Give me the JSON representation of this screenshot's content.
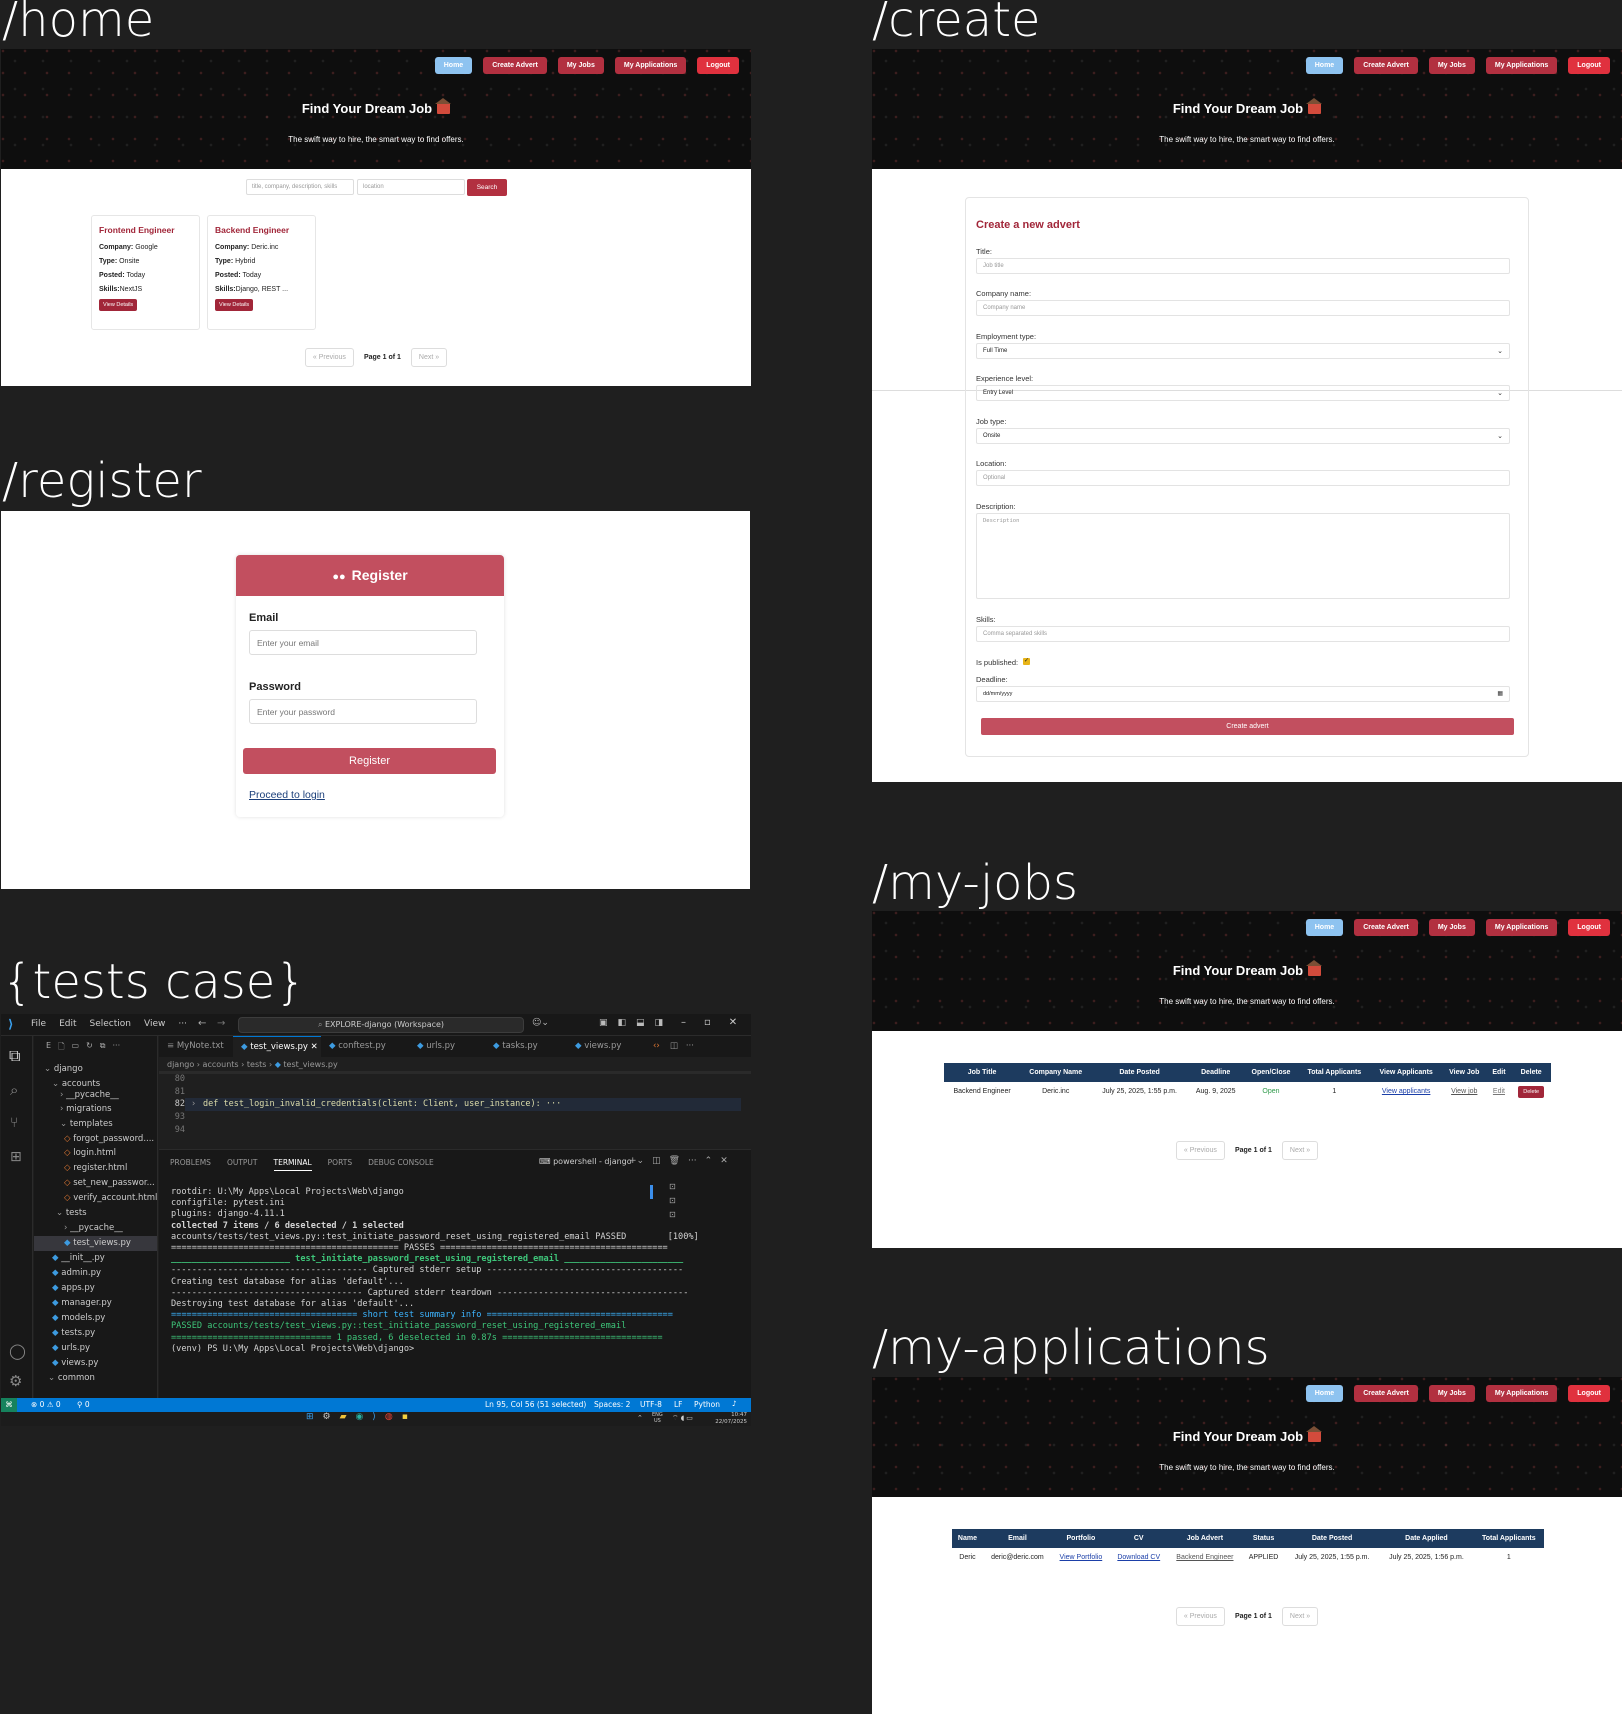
{
  "headings": {
    "home": "/home",
    "create": "/create",
    "register": "/register",
    "my_jobs": "/my-jobs",
    "tests": "{tests case}",
    "my_applications": "/my-applications"
  },
  "site": {
    "nav": [
      "Home",
      "Create Advert",
      "My Jobs",
      "My Applications",
      "Logout"
    ],
    "hero_title": "Find Your Dream Job",
    "hero_subtitle": "The swift way to hire, the smart way to find offers.",
    "pager": {
      "previous": "« Previous",
      "info": "Page 1 of 1",
      "next": "Next »"
    }
  },
  "home": {
    "search_placeholder": "title, company, description, skills",
    "location_placeholder": "location",
    "search_button": "Search",
    "jobs": [
      {
        "title": "Frontend Engineer",
        "company_label": "Company:",
        "company": "Google",
        "type_label": "Type:",
        "type": "Onsite",
        "posted_label": "Posted:",
        "posted": "Today",
        "skills_label": "Skills:",
        "skills": "NextJS",
        "button": "View Details"
      },
      {
        "title": "Backend Engineer",
        "company_label": "Company:",
        "company": "Deric.inc",
        "type_label": "Type:",
        "type": "Hybrid",
        "posted_label": "Posted:",
        "posted": "Today",
        "skills_label": "Skills:",
        "skills": "Django, REST ...",
        "button": "View Details"
      }
    ]
  },
  "register": {
    "title": "Register",
    "email_label": "Email",
    "email_placeholder": "Enter your email",
    "password_label": "Password",
    "password_placeholder": "Enter your password",
    "button": "Register",
    "login_link": "Proceed to login"
  },
  "create": {
    "title": "Create a new advert",
    "fields": {
      "title_label": "Title:",
      "title_placeholder": "Job title",
      "company_label": "Company name:",
      "company_placeholder": "Company name",
      "employment_label": "Employment type:",
      "employment_value": "Full Time",
      "experience_label": "Experience level:",
      "experience_value": "Entry Level",
      "jobtype_label": "Job type:",
      "jobtype_value": "Onsite",
      "location_label": "Location:",
      "location_placeholder": "Optional",
      "description_label": "Description:",
      "description_placeholder": "Description",
      "skills_label": "Skills:",
      "skills_placeholder": "Comma separated skills",
      "published_label": "Is published:",
      "published_checked": true,
      "deadline_label": "Deadline:",
      "deadline_placeholder": "dd/mm/yyyy"
    },
    "button": "Create advert"
  },
  "my_jobs": {
    "headers": [
      "Job Title",
      "Company Name",
      "Date Posted",
      "Deadline",
      "Open/Close",
      "Total Applicants",
      "View Applicants",
      "View Job",
      "Edit",
      "Delete"
    ],
    "row": {
      "title": "Backend Engineer",
      "company": "Deric.inc",
      "posted": "July 25, 2025, 1:55 p.m.",
      "deadline": "Aug. 9, 2025",
      "status": "Open",
      "total": "1",
      "view_applicants": "View applicants",
      "view_job": "View job",
      "edit": "Edit",
      "delete": "Delete"
    }
  },
  "my_applications": {
    "headers": [
      "Name",
      "Email",
      "Portfolio",
      "CV",
      "Job Advert",
      "Status",
      "Date Posted",
      "Date Applied",
      "Total Applicants"
    ],
    "row": {
      "name": "Deric",
      "email": "deric@deric.com",
      "portfolio": "View Portfolio",
      "cv": "Download CV",
      "advert": "Backend Engineer",
      "status": "APPLIED",
      "posted": "July 25, 2025, 1:55 p.m.",
      "applied": "July 25, 2025, 1:56 p.m.",
      "total": "1"
    }
  },
  "vscode": {
    "menu": [
      "File",
      "Edit",
      "Selection",
      "View",
      "···"
    ],
    "search": "EXPLORE-django (Workspace)",
    "tabs": [
      "MyNote.txt",
      "test_views.py",
      "conftest.py",
      "urls.py",
      "tasks.py",
      "views.py"
    ],
    "breadcrumb": [
      "django",
      "accounts",
      "tests",
      "test_views.py"
    ],
    "tree": [
      "django",
      "accounts",
      "__pycache__",
      "migrations",
      "templates",
      "forgot_password....",
      "login.html",
      "register.html",
      "set_new_passwor...",
      "verify_account.html",
      "tests",
      "__pycache__",
      "test_views.py",
      "__init__.py",
      "admin.py",
      "apps.py",
      "manager.py",
      "models.py",
      "tests.py",
      "urls.py",
      "views.py",
      "common"
    ],
    "code_lines": [
      {
        "num": "80",
        "text": ""
      },
      {
        "num": "81",
        "text": ""
      },
      {
        "num": "82",
        "text": "def test_login_invalid_credentials(client: Client, user_instance): ···"
      },
      {
        "num": "93",
        "text": ""
      },
      {
        "num": "94",
        "text": ""
      }
    ],
    "panel_tabs": [
      "PROBLEMS",
      "OUTPUT",
      "TERMINAL",
      "PORTS",
      "DEBUG CONSOLE"
    ],
    "shell": "powershell - django",
    "terminal": [
      "rootdir: U:\\My Apps\\Local Projects\\Web\\django",
      "configfile: pytest.ini",
      "plugins: django-4.11.1",
      "collected 7 items / 6 deselected / 1 selected",
      "",
      "accounts/tests/test_views.py::test_initiate_password_reset_using_registered_email PASSED        [100%]",
      "",
      "============================================ PASSES ============================================",
      "_______________________ test_initiate_password_reset_using_registered_email _______________________",
      "-------------------------------------- Captured stderr setup --------------------------------------",
      "Creating test database for alias 'default'...",
      "------------------------------------- Captured stderr teardown -------------------------------------",
      "Destroying test database for alias 'default'...",
      "==================================== short test summary info ====================================",
      "PASSED accounts/tests/test_views.py::test_initiate_password_reset_using_registered_email",
      "=============================== 1 passed, 6 deselected in 0.87s ===============================",
      "(venv) PS U:\\My Apps\\Local Projects\\Web\\django> "
    ],
    "status": {
      "problems": "⊗ 0 ⚠ 0",
      "ports": "⚲ 0",
      "position": "Ln 95, Col 56 (51 selected)",
      "spaces": "Spaces: 2",
      "encoding": "UTF-8",
      "eol": "LF",
      "lang": "Python"
    },
    "taskbar": {
      "lang": "ENG\nUS",
      "time": "10:47",
      "date": "22/07/2025"
    }
  },
  "colors": {
    "primary": "#b23040",
    "home_btn": "#8ec3f0",
    "logout": "#e0313e",
    "table_head": "#1d3b5f",
    "register_head": "#c24f5f",
    "vscode_status": "#0078d4"
  }
}
